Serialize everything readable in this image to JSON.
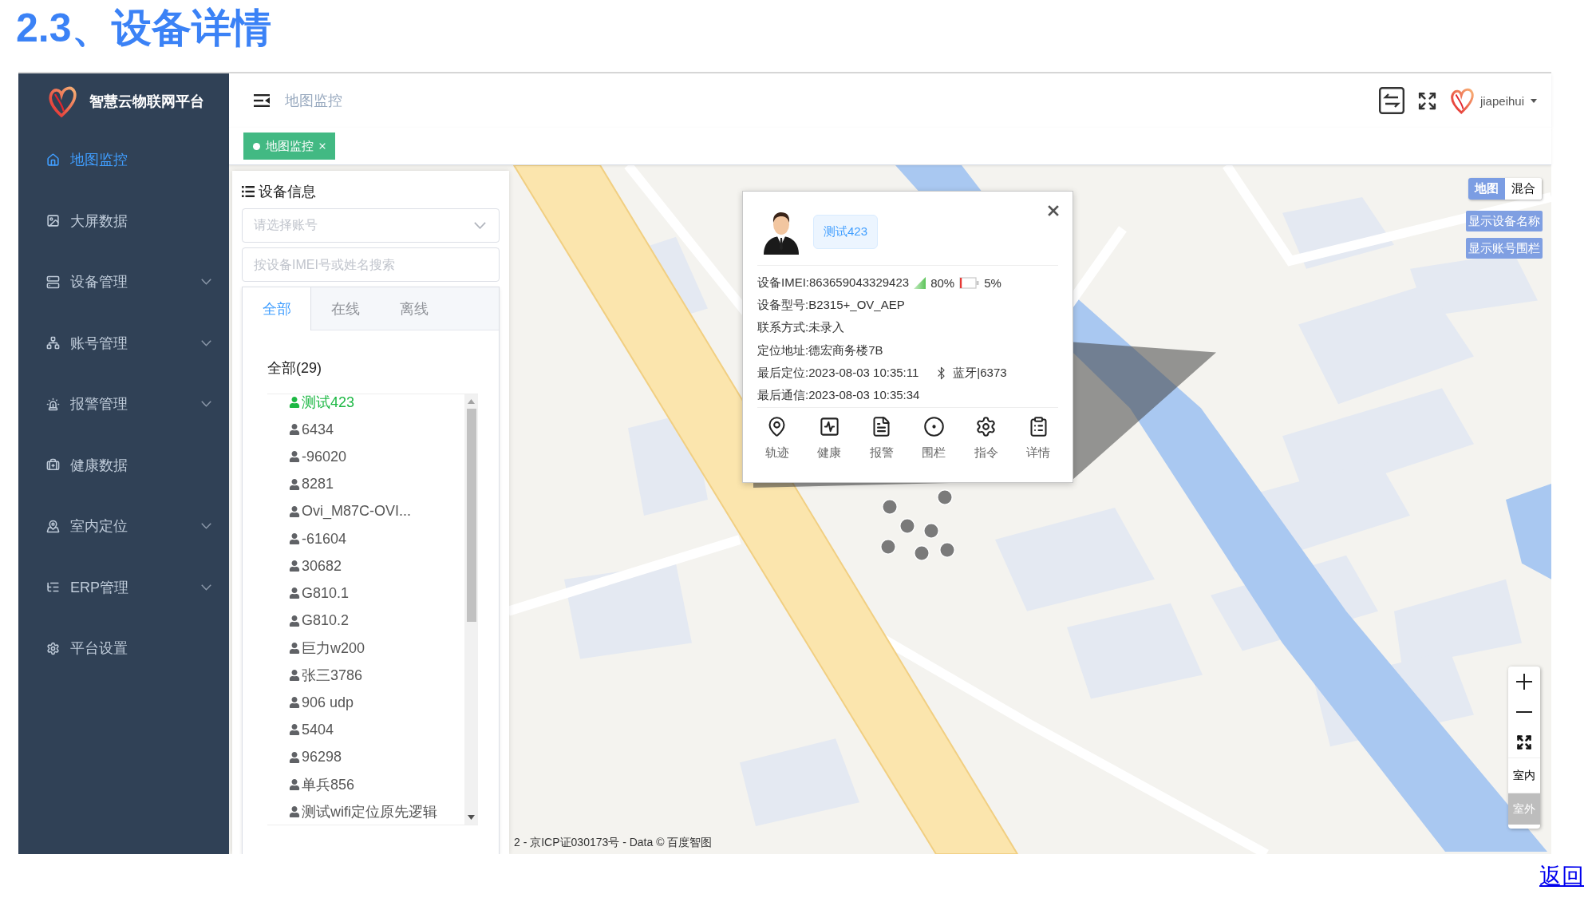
{
  "page_title": "2.3、设备详情",
  "sidebar": {
    "brand": "智慧云物联网平台",
    "items": [
      {
        "label": "地图监控",
        "selected": true,
        "has_submenu": false
      },
      {
        "label": "大屏数据",
        "selected": false,
        "has_submenu": false
      },
      {
        "label": "设备管理",
        "selected": false,
        "has_submenu": true
      },
      {
        "label": "账号管理",
        "selected": false,
        "has_submenu": true
      },
      {
        "label": "报警管理",
        "selected": false,
        "has_submenu": true
      },
      {
        "label": "健康数据",
        "selected": false,
        "has_submenu": false
      },
      {
        "label": "室内定位",
        "selected": false,
        "has_submenu": true
      },
      {
        "label": "ERP管理",
        "selected": false,
        "has_submenu": true
      },
      {
        "label": "平台设置",
        "selected": false,
        "has_submenu": false
      }
    ]
  },
  "header": {
    "breadcrumb": "地图监控",
    "user": "jiapeihui"
  },
  "tags": [
    {
      "label": "地图监控",
      "selected": true
    }
  ],
  "device_panel": {
    "title": "设备信息",
    "account_select": {
      "placeholder": "请选择账号"
    },
    "search": {
      "placeholder": "按设备IMEI号或姓名搜索"
    },
    "tabs": [
      {
        "label": "全部",
        "selected": true
      },
      {
        "label": "在线",
        "selected": false
      },
      {
        "label": "离线",
        "selected": false
      }
    ],
    "group_label": "全部(29)",
    "devices": [
      {
        "name": "测试423",
        "online": true
      },
      {
        "name": "6434",
        "online": false
      },
      {
        "name": "-96020",
        "online": false
      },
      {
        "name": "8281",
        "online": false
      },
      {
        "name": "Ovi_M87C-OVI...",
        "online": false
      },
      {
        "name": "-61604",
        "online": false
      },
      {
        "name": "30682",
        "online": false
      },
      {
        "name": "G810.1",
        "online": false
      },
      {
        "name": "G810.2",
        "online": false
      },
      {
        "name": "巨力w200",
        "online": false
      },
      {
        "name": "张三3786",
        "online": false
      },
      {
        "name": "906 udp",
        "online": false
      },
      {
        "name": "5404",
        "online": false
      },
      {
        "name": "96298",
        "online": false
      },
      {
        "name": "单兵856",
        "online": false
      },
      {
        "name": "测试wifi定位原先逻辑",
        "online": false
      }
    ]
  },
  "device_popup": {
    "name": "测试423",
    "rows": [
      {
        "text": "设备IMEI:863659043329423",
        "extras": [
          {
            "kind": "signal",
            "text": "80%"
          },
          {
            "kind": "battery",
            "text": "5%"
          }
        ]
      },
      {
        "text": "设备型号:B2315+_OV_AEP"
      },
      {
        "text": "联系方式:未录入"
      },
      {
        "text": "定位地址:德宏商务楼7B"
      },
      {
        "text": "最后定位:2023-08-03 10:35:11",
        "extras": [
          {
            "kind": "bluetooth",
            "text": "蓝牙|6373"
          }
        ]
      },
      {
        "text": "最后通信:2023-08-03 10:35:34"
      }
    ],
    "actions": [
      "轨迹",
      "健康",
      "报警",
      "围栏",
      "指令",
      "详情"
    ]
  },
  "map": {
    "types": [
      {
        "label": "地图",
        "selected": true
      },
      {
        "label": "混合",
        "selected": false
      }
    ],
    "buttons": [
      "显示设备名称",
      "显示账号围栏"
    ],
    "floor_switch": [
      {
        "label": "室内",
        "selected": false
      },
      {
        "label": "室外",
        "selected": true
      }
    ],
    "attribution": "2 - 京ICP证030173号 - Data © 百度智图"
  },
  "back_link": "返回"
}
